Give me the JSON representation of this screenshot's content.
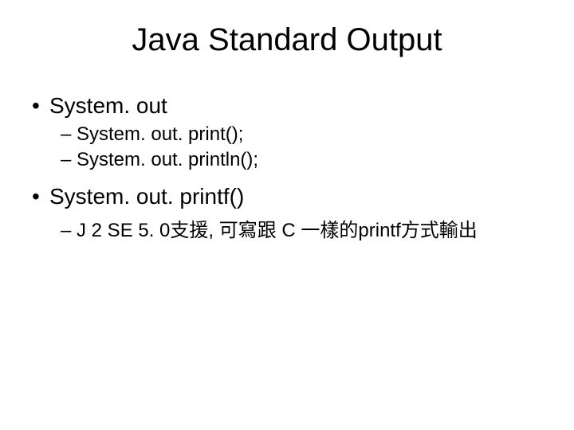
{
  "title": "Java Standard Output",
  "bullets": [
    {
      "text": "System. out",
      "sub": [
        "System. out. print();",
        "System. out. println();"
      ]
    },
    {
      "text": "System. out. printf()",
      "sub": [
        "J 2 SE 5. 0支援, 可寫跟 C 一樣的printf方式輸出"
      ]
    }
  ]
}
